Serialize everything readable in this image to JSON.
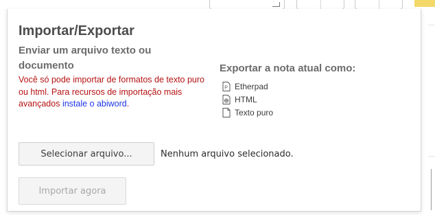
{
  "dialog": {
    "title": "Importar/Exportar",
    "import_heading": "Enviar um arquivo texto ou documento",
    "notice": {
      "text": "Você só pode importar de formatos de texto puro ou html. Para recursos de importação mais avançados ",
      "link_text": "instale o abiword",
      "suffix": "."
    },
    "file_input": {
      "button_label": "Selecionar arquivo...",
      "status": "Nenhum arquivo selecionado."
    },
    "import_button_label": "Importar agora",
    "export": {
      "heading": "Exportar a nota atual como:",
      "options": [
        {
          "label": "Etherpad",
          "icon": "etherpad-file-icon"
        },
        {
          "label": "HTML",
          "icon": "html-file-icon"
        },
        {
          "label": "Texto puro",
          "icon": "plain-text-file-icon"
        }
      ]
    }
  },
  "colors": {
    "notice_text": "#b51212",
    "link": "#1f35e6",
    "heading": "#4c4c4c",
    "subheading": "#6b6b6b",
    "toolbar_accent": "#f3d86a"
  }
}
